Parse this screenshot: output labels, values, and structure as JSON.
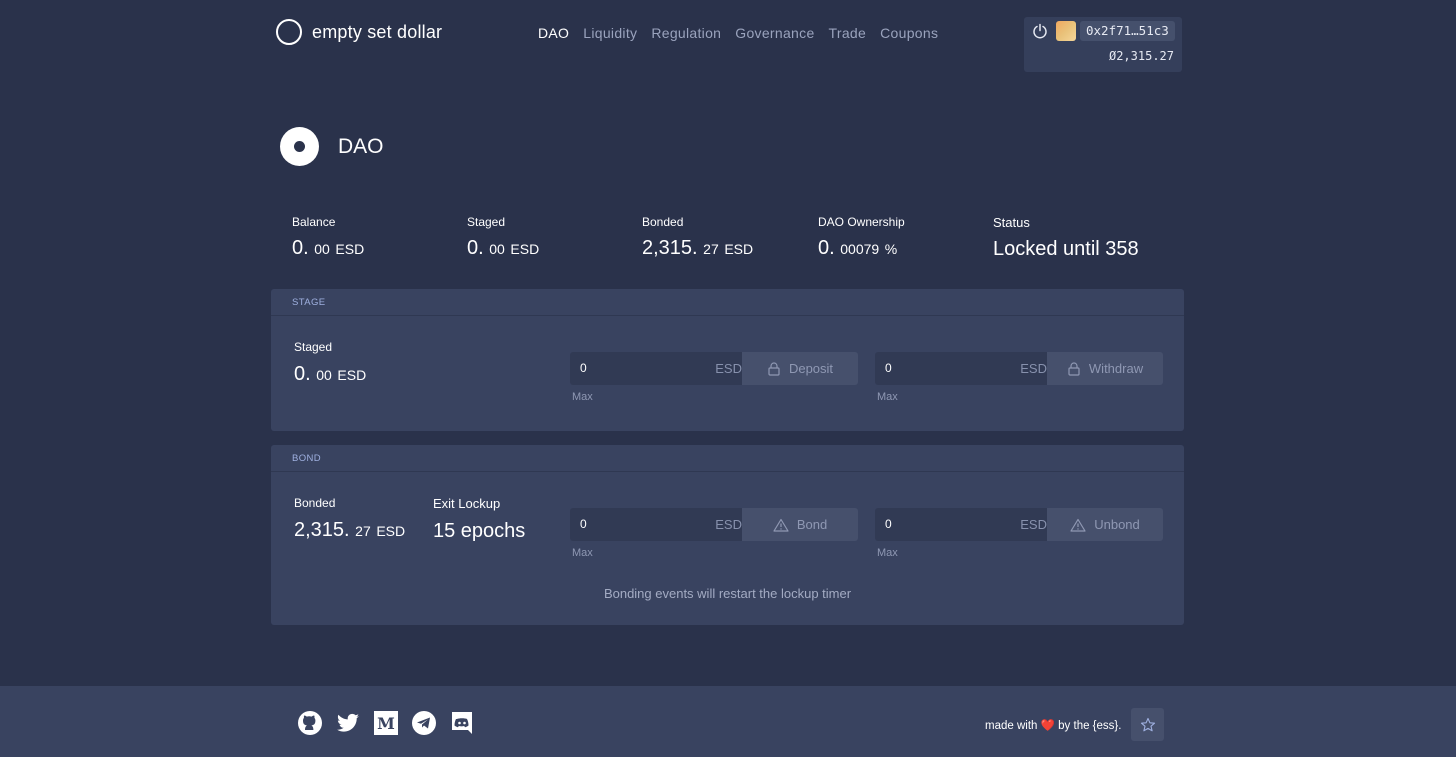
{
  "brand": {
    "name": "empty set dollar"
  },
  "nav": [
    {
      "label": "DAO",
      "active": true
    },
    {
      "label": "Liquidity",
      "active": false
    },
    {
      "label": "Regulation",
      "active": false
    },
    {
      "label": "Governance",
      "active": false
    },
    {
      "label": "Trade",
      "active": false
    },
    {
      "label": "Coupons",
      "active": false
    }
  ],
  "wallet": {
    "address": "0x2f71…51c3",
    "balance": "Ø2,315.27"
  },
  "page": {
    "title": "DAO"
  },
  "stats": [
    {
      "label": "Balance",
      "int": "0.",
      "dec": "00",
      "unit": "ESD"
    },
    {
      "label": "Staged",
      "int": "0.",
      "dec": "00",
      "unit": "ESD"
    },
    {
      "label": "Bonded",
      "int": "2,315.",
      "dec": "27",
      "unit": "ESD"
    },
    {
      "label": "DAO Ownership",
      "int": "0.",
      "dec": "00079",
      "unit": "%"
    },
    {
      "label": "Status",
      "text": "Locked until 358"
    }
  ],
  "stage": {
    "header": "STAGE",
    "label": "Staged",
    "int": "0.",
    "dec": "00",
    "unit": "ESD",
    "deposit": {
      "value": "0",
      "unit": "ESD",
      "button": "Deposit",
      "max": "Max"
    },
    "withdraw": {
      "value": "0",
      "unit": "ESD",
      "button": "Withdraw",
      "max": "Max"
    }
  },
  "bond": {
    "header": "BOND",
    "label": "Bonded",
    "int": "2,315.",
    "dec": "27",
    "unit": "ESD",
    "exit_label": "Exit Lockup",
    "exit_value": "15 epochs",
    "bond": {
      "value": "0",
      "unit": "ESD",
      "button": "Bond",
      "max": "Max"
    },
    "unbond": {
      "value": "0",
      "unit": "ESD",
      "button": "Unbond",
      "max": "Max"
    },
    "note": "Bonding events will restart the lockup timer"
  },
  "footer": {
    "made_prefix": "made with",
    "heart": "❤️",
    "made_suffix": "by the {ess}.",
    "icons": [
      "github-icon",
      "twitter-icon",
      "medium-icon",
      "telegram-icon",
      "discord-icon"
    ]
  },
  "colors": {
    "background": "#2a324b",
    "panel": "#394360",
    "accent": "#9fb0e0"
  }
}
